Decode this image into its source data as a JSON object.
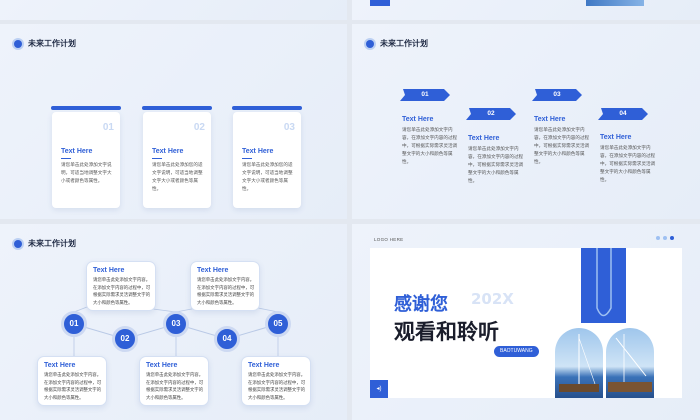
{
  "section_title": "未来工作计划",
  "slide1": {
    "cards": [
      {
        "num": "01",
        "title": "Text Here",
        "text": "请您单击此处添加文字说明，可适当地调整文字大小或者颜色等属性。"
      },
      {
        "num": "02",
        "title": "Text Here",
        "text": "请您单击此处添加您的适文字说明，可适当地调整文字大小或者颜色等属性。"
      },
      {
        "num": "03",
        "title": "Text Here",
        "text": "请您单击此处添加您的适文字说明，可适当地调整文字大小或者颜色等属性。"
      }
    ]
  },
  "slide2": {
    "steps": [
      {
        "num": "01",
        "title": "Text Here",
        "text": "请您单击此处添加文字内容，在添加文字内容的过程中，可根据实际需求灵活调整文字的大小和颜色等属性。"
      },
      {
        "num": "02",
        "title": "Text Here",
        "text": "请您单击此处添加文字内容，在添加文字内容的过程中，可根据实际需求灵活调整文字的大小和颜色等属性。"
      },
      {
        "num": "03",
        "title": "Text Here",
        "text": "请您单击此处添加文字内容，在添加文字内容的过程中，可根据实际需求灵活调整文字的大小和颜色等属性。"
      },
      {
        "num": "04",
        "title": "Text Here",
        "text": "请您单击此处添加文字内容，在添加文字内容的过程中，可根据实际需求灵活调整文字的大小和颜色等属性。"
      }
    ]
  },
  "slide3": {
    "nodes": [
      "01",
      "02",
      "03",
      "04",
      "05"
    ],
    "bubbles": [
      {
        "title": "Text Here",
        "text": "请您单击此处添加文字内容。在添加文字内容的过程中，可根据实际需求灵活调整文字的大小和颜色等属性。"
      },
      {
        "title": "Text Here",
        "text": "请您单击此处添加文字内容。在添加文字内容的过程中，可根据实际需求灵活调整文字的大小和颜色等属性。"
      },
      {
        "title": "Text Here",
        "text": "请您单击此处添加文字内容。在添加文字内容的过程中，可根据实际需求灵活调整文字的大小和颜色等属性。"
      },
      {
        "title": "Text Here",
        "text": "请您单击此处添加文字内容。在添加文字内容的过程中，可根据实际需求灵活调整文字的大小和颜色等属性。"
      },
      {
        "title": "Text Here",
        "text": "请您单击此处添加文字内容。在添加文字内容的过程中，可根据实际需求灵活调整文字的大小和颜色等属性。"
      }
    ]
  },
  "slide4": {
    "logo": "LOGO HERE",
    "thanks_line1": "感谢您",
    "year": "202X",
    "thanks_line2": "观看和聆听",
    "tag": "BAOTUWANG",
    "nav": "◂)"
  },
  "colors": {
    "accent": "#2f5fd7",
    "light_accent": "#c9d9f3",
    "background": "#eef3fb"
  }
}
